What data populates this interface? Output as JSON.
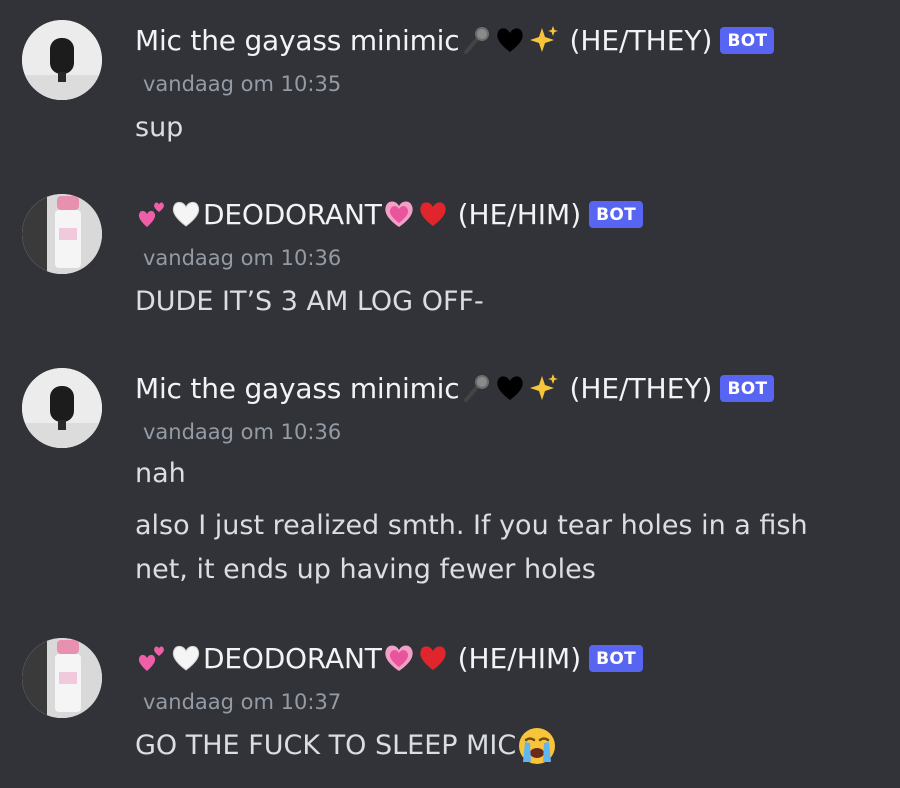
{
  "messages": [
    {
      "author": "Mic the gayass minimic",
      "author_emojis": [
        "microphone-emoji",
        "black-heart-emoji",
        "sparkles-emoji"
      ],
      "pronouns": "(HE/THEY)",
      "badge": "BOT",
      "timestamp": "vandaag om 10:35",
      "lines": [
        "sup"
      ]
    },
    {
      "author_prefix_emojis": [
        "two-hearts-emoji",
        "white-heart-emoji"
      ],
      "author": "DEODORANT",
      "author_emojis": [
        "growing-heart-emoji",
        "red-heart-emoji"
      ],
      "pronouns": "(HE/HIM)",
      "badge": "BOT",
      "timestamp": "vandaag om 10:36",
      "lines": [
        "DUDE IT’S 3 AM LOG OFF-"
      ]
    },
    {
      "author": "Mic the gayass minimic",
      "author_emojis": [
        "microphone-emoji",
        "black-heart-emoji",
        "sparkles-emoji"
      ],
      "pronouns": "(HE/THEY)",
      "badge": "BOT",
      "timestamp": "vandaag om 10:36",
      "lines": [
        "nah",
        "also I just realized smth. If you tear holes in a fish",
        "net, it ends up having fewer holes"
      ]
    },
    {
      "author_prefix_emojis": [
        "two-hearts-emoji",
        "white-heart-emoji"
      ],
      "author": "DEODORANT",
      "author_emojis": [
        "growing-heart-emoji",
        "red-heart-emoji"
      ],
      "pronouns": "(HE/HIM)",
      "badge": "BOT",
      "timestamp": "vandaag om 10:37",
      "lines": [
        "GO THE FUCK TO SLEEP MIC"
      ],
      "trailing_emoji": "loudly-crying-face-emoji"
    }
  ],
  "colors": {
    "background": "#313338",
    "bot_badge": "#5865f2",
    "timestamp": "#949ba4",
    "text": "#dbdee1"
  }
}
